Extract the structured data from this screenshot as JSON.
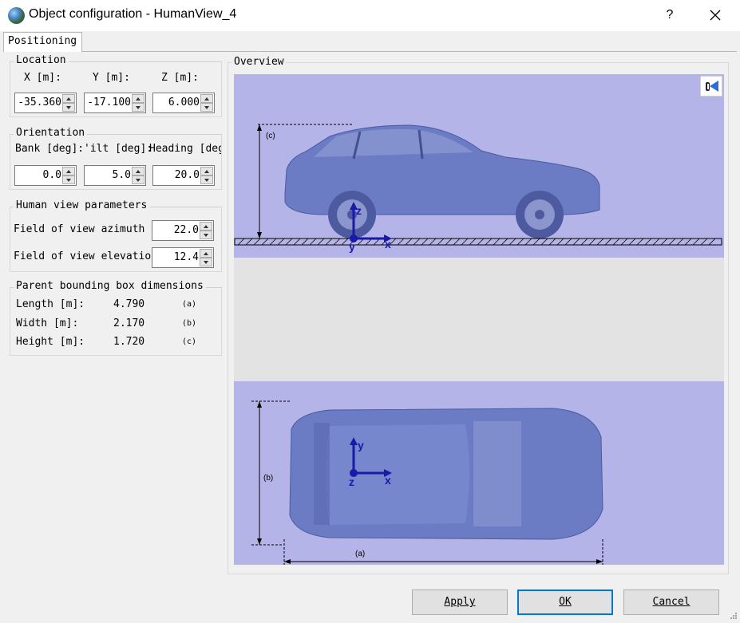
{
  "window": {
    "title": "Object configuration - HumanView_4",
    "help": "?"
  },
  "tabs": [
    {
      "label": "Positioning"
    }
  ],
  "location": {
    "title": "Location",
    "x_label": "X [m]:",
    "y_label": "Y [m]:",
    "z_label": "Z [m]:",
    "x_value": "-35.360",
    "y_value": "-17.100",
    "z_value": "6.000"
  },
  "orientation": {
    "title": "Orientation",
    "bank_label": "Bank [deg]:",
    "tilt_label": "'ilt [deg]:",
    "heading_label": "Heading [deg",
    "bank_value": "0.0",
    "tilt_value": "5.0",
    "heading_value": "20.0"
  },
  "human_view": {
    "title": "Human view parameters",
    "azimuth_label": "Field of view azimuth [",
    "azimuth_value": "22.0",
    "elevation_label": "Field of view elevation",
    "elevation_value": "12.4"
  },
  "bbox": {
    "title": "Parent bounding box dimensions",
    "rows": [
      {
        "label": "Length [m]:",
        "value": "4.790",
        "tag": "(a)"
      },
      {
        "label": "Width [m]:",
        "value": "2.170",
        "tag": "(b)"
      },
      {
        "label": "Height [m]:",
        "value": "1.720",
        "tag": "(c)"
      }
    ]
  },
  "overview": {
    "title": "Overview",
    "side_dim_label": "(c)",
    "top_width_label": "(b)",
    "top_length_label": "(a)",
    "axis_x": "x",
    "axis_y": "y",
    "axis_z": "z"
  },
  "buttons": {
    "apply": "Apply",
    "ok": "OK",
    "cancel": "Cancel"
  },
  "colors": {
    "panel_bg": "#b4b4e8",
    "car_body": "#6b7cc4",
    "axis": "#1a1aa8"
  },
  "icons": {
    "app": "globe-icon",
    "close": "close-icon",
    "camera": "camera-icon"
  }
}
